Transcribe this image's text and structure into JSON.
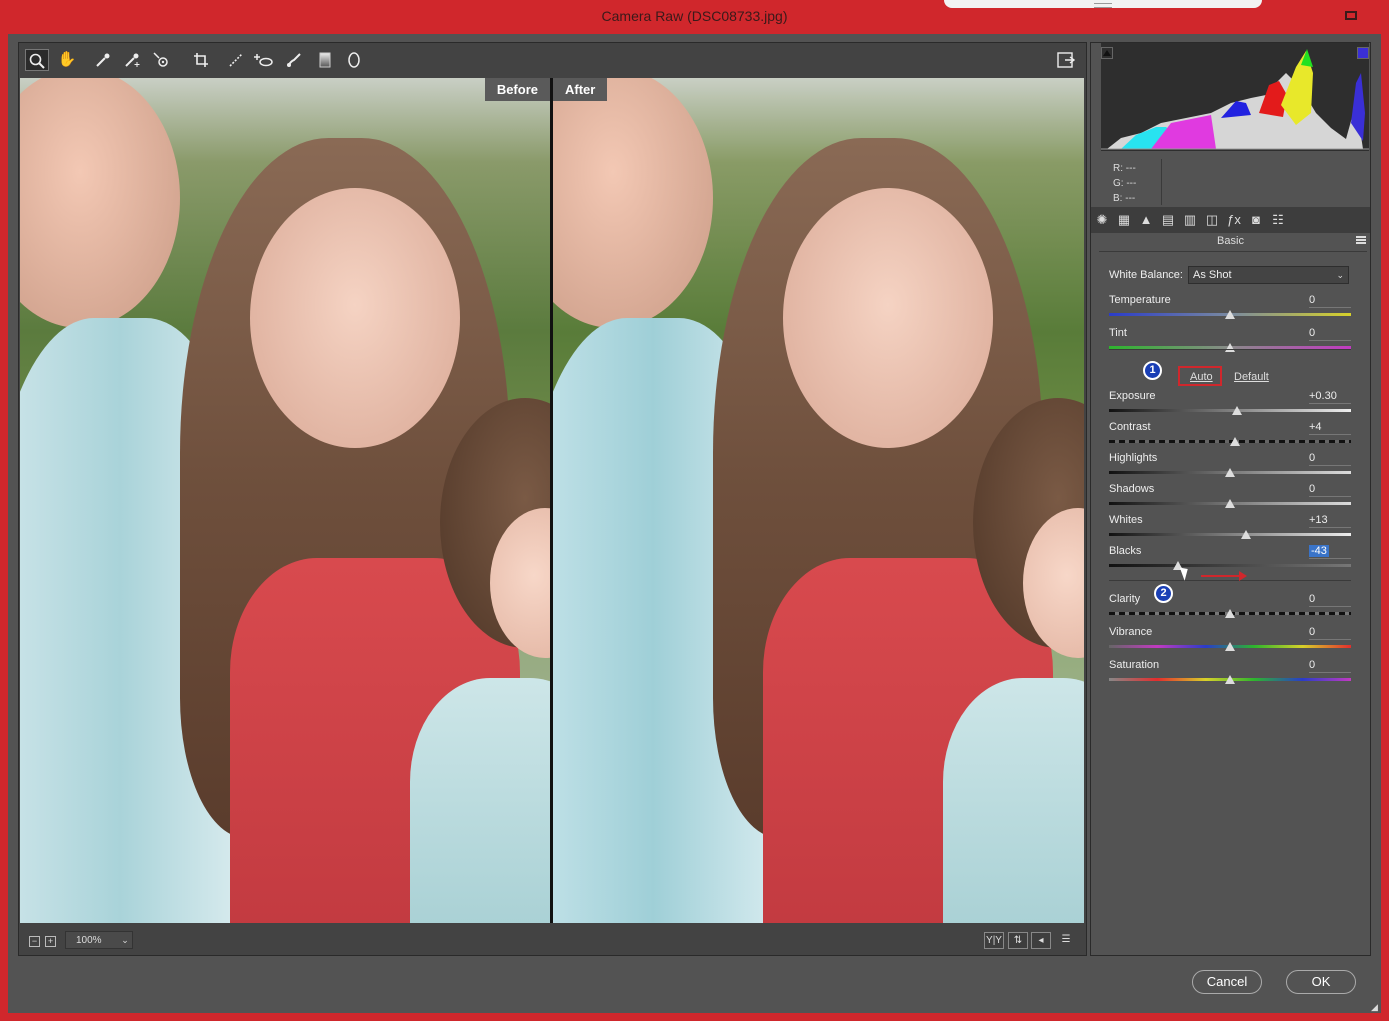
{
  "window": {
    "title": "Camera Raw (DSC08733.jpg)"
  },
  "toolbar": {
    "tools": [
      "zoom-tool",
      "hand-tool",
      "white-balance-tool",
      "color-sampler-tool",
      "targeted-adjustment-tool",
      "crop-tool",
      "straighten-tool",
      "spot-removal-tool",
      "red-eye-removal-tool",
      "adjustment-brush",
      "graduated-filter",
      "radial-filter"
    ],
    "open_preferences_icon": "preferences-icon"
  },
  "preview": {
    "before_label": "Before",
    "after_label": "After"
  },
  "status": {
    "zoom": "100%"
  },
  "histogram": {
    "rgb": [
      {
        "label": "R:",
        "value": "---"
      },
      {
        "label": "G:",
        "value": "---"
      },
      {
        "label": "B:",
        "value": "---"
      }
    ]
  },
  "panel": {
    "section_title": "Basic",
    "white_balance": {
      "label": "White Balance:",
      "value": "As Shot"
    },
    "auto_label": "Auto",
    "default_label": "Default",
    "sliders": [
      {
        "key": "temperature",
        "label": "Temperature",
        "value": "0",
        "level": 0.5
      },
      {
        "key": "tint",
        "label": "Tint",
        "value": "0",
        "level": 0.5
      },
      {
        "key": "exposure",
        "label": "Exposure",
        "value": "+0.30",
        "level": 0.53
      },
      {
        "key": "contrast",
        "label": "Contrast",
        "value": "+4",
        "level": 0.52
      },
      {
        "key": "highlights",
        "label": "Highlights",
        "value": "0",
        "level": 0.5
      },
      {
        "key": "shadows",
        "label": "Shadows",
        "value": "0",
        "level": 0.5
      },
      {
        "key": "whites",
        "label": "Whites",
        "value": "+13",
        "level": 0.565
      },
      {
        "key": "blacks",
        "label": "Blacks",
        "value": "-43",
        "level": 0.285
      },
      {
        "key": "clarity",
        "label": "Clarity",
        "value": "0",
        "level": 0.5
      },
      {
        "key": "vibrance",
        "label": "Vibrance",
        "value": "0",
        "level": 0.5
      },
      {
        "key": "saturation",
        "label": "Saturation",
        "value": "0",
        "level": 0.5
      }
    ]
  },
  "annotations": {
    "badge1": "1",
    "badge2": "2"
  },
  "footer": {
    "cancel_label": "Cancel",
    "ok_label": "OK"
  },
  "colors": {
    "frame": "#d0272c",
    "panel": "#535353",
    "badge": "#1a3fb5",
    "highlight": "#3a74c9"
  }
}
